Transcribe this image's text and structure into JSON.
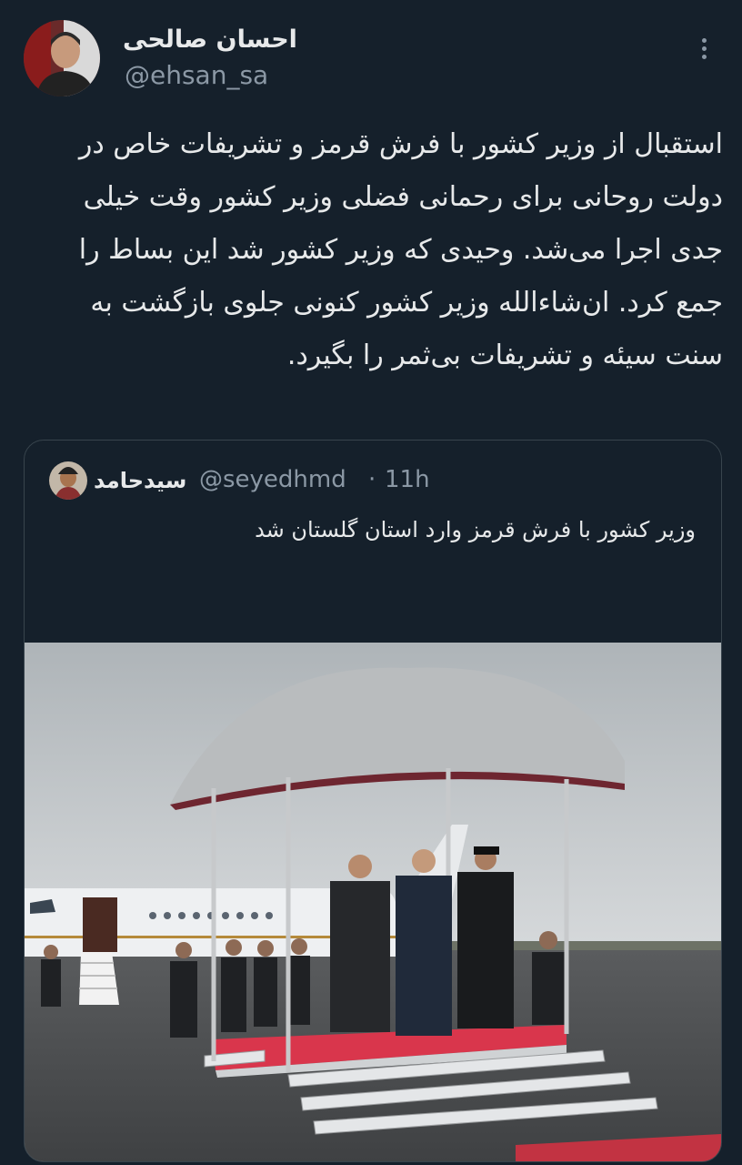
{
  "author": {
    "display_name": "احسان صالحی",
    "handle": "@ehsan_sa"
  },
  "tweet": {
    "text": "استقبال از وزیر کشور با فرش قرمز و تشریفات خاص در دولت روحانی برای رحمانی فضلی وزیر کشور وقت خیلی جدی اجرا می‌شد. وحیدی که وزیر کشور شد این بساط را جمع کرد. ان‌شاءالله وزیر کشور کنونی جلوی بازگشت به سنت سیئه و تشریفات بی‌ثمر را بگیرد."
  },
  "quoted_tweet": {
    "display_name": "سیدحامد",
    "handle": "@seyedhmd",
    "separator": "·",
    "time": "11h",
    "text": "وزیر کشور با فرش قرمز وارد استان گلستان شد"
  },
  "icons": {
    "more": "more-vertical-icon"
  },
  "colors": {
    "background": "#15202b",
    "text_primary": "#e7e9ea",
    "text_secondary": "#8b98a5",
    "border": "#38444d",
    "red_carpet": "#d9364c"
  }
}
